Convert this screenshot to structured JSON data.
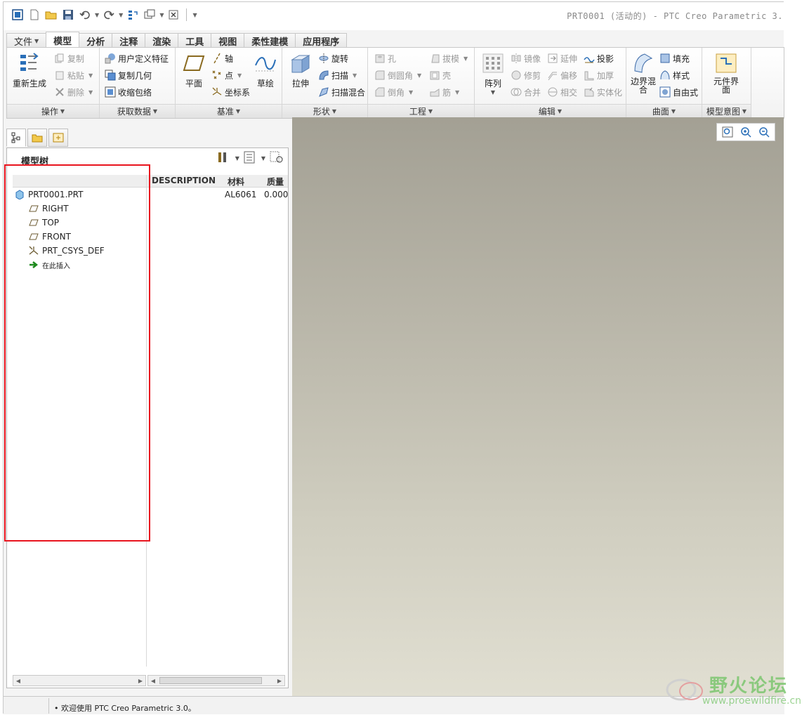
{
  "window": {
    "title": "PRT0001 (活动的) - PTC Creo Parametric 3."
  },
  "ribbon": {
    "tabs": [
      {
        "label": "文件"
      },
      {
        "label": "模型"
      },
      {
        "label": "分析"
      },
      {
        "label": "注释"
      },
      {
        "label": "渲染"
      },
      {
        "label": "工具"
      },
      {
        "label": "视图"
      },
      {
        "label": "柔性建模"
      },
      {
        "label": "应用程序"
      }
    ],
    "active_tab": "模型",
    "groups": {
      "operations": {
        "label": "操作",
        "regenerate": "重新生成",
        "copy": "复制",
        "paste": "粘贴",
        "delete": "删除"
      },
      "get_data": {
        "label": "获取数据",
        "udf": "用户定义特征",
        "copy_geom": "复制几何",
        "shrinkwrap": "收缩包络"
      },
      "datum": {
        "label": "基准",
        "plane": "平面",
        "axis": "轴",
        "point": "点",
        "csys": "坐标系",
        "sketch": "草绘"
      },
      "shapes": {
        "label": "形状",
        "extrude": "拉伸",
        "revolve": "旋转",
        "sweep": "扫描",
        "swept_blend": "扫描混合"
      },
      "engineering": {
        "label": "工程",
        "hole": "孔",
        "round": "倒圆角",
        "chamfer": "倒角",
        "draft": "拔模",
        "shell": "壳",
        "rib": "筋"
      },
      "editing": {
        "label": "编辑",
        "pattern": "阵列",
        "mirror": "镜像",
        "trim": "修剪",
        "merge": "合并",
        "extend": "延伸",
        "offset": "偏移",
        "intersect": "相交",
        "project": "投影",
        "thicken": "加厚",
        "solidify": "实体化"
      },
      "surfaces": {
        "label": "曲面",
        "boundary_blend": "边界混合",
        "fill": "填充",
        "style": "样式",
        "freestyle": "自由式"
      },
      "model_intent": {
        "label": "模型意图",
        "component_interface": "元件界面"
      }
    }
  },
  "model_tree": {
    "title": "模型树",
    "columns": {
      "description": "DESCRIPTION",
      "material": "材料",
      "mass": "质量"
    },
    "root": {
      "name": "PRT0001.PRT",
      "material": "AL6061",
      "mass": "0.0000"
    },
    "items": [
      {
        "name": "RIGHT",
        "icon": "datum-plane-icon"
      },
      {
        "name": "TOP",
        "icon": "datum-plane-icon"
      },
      {
        "name": "FRONT",
        "icon": "datum-plane-icon"
      },
      {
        "name": "PRT_CSYS_DEF",
        "icon": "csys-icon"
      },
      {
        "name": "在此插入",
        "icon": "insert-here-arrow-icon"
      }
    ]
  },
  "status": {
    "message": "• 欢迎使用 PTC Creo Parametric 3.0。"
  },
  "watermark": {
    "title": "野火论坛",
    "url": "www.proewildfire.cn"
  },
  "colors": {
    "highlight_box": "#e8141e",
    "viewport_top": "#a3a094",
    "viewport_bottom": "#e1dfd2",
    "watermark": "#7cc66f"
  }
}
